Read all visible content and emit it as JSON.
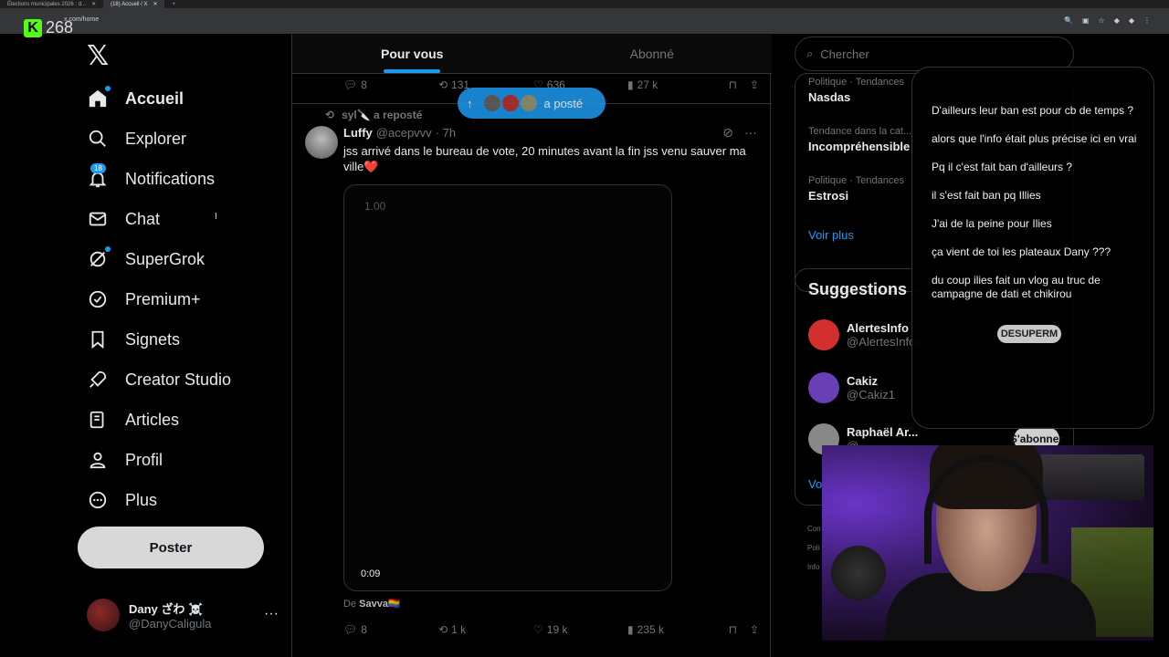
{
  "browser": {
    "tabs": [
      {
        "label": "Élections municipales 2026 : d..."
      },
      {
        "label": "(18) Accueil / X"
      }
    ],
    "url": "x.com/home"
  },
  "stream": {
    "viewer_count": "268"
  },
  "nav": {
    "items": [
      {
        "label": "Accueil",
        "icon": "home-icon"
      },
      {
        "label": "Explorer",
        "icon": "search-icon"
      },
      {
        "label": "Notifications",
        "icon": "bell-icon",
        "badge": "18"
      },
      {
        "label": "Chat",
        "icon": "mail-icon"
      },
      {
        "label": "SuperGrok",
        "icon": "grok-icon"
      },
      {
        "label": "Premium+",
        "icon": "verified-icon"
      },
      {
        "label": "Signets",
        "icon": "bookmark-icon"
      },
      {
        "label": "Creator Studio",
        "icon": "rocket-icon"
      },
      {
        "label": "Articles",
        "icon": "article-icon"
      },
      {
        "label": "Profil",
        "icon": "user-icon"
      },
      {
        "label": "Plus",
        "icon": "more-circle-icon"
      }
    ],
    "post_button": "Poster",
    "account": {
      "name": "Dany ざわ ☠️",
      "handle": "@DanyCaligula"
    }
  },
  "feed": {
    "tabs": [
      {
        "label": "Pour vous"
      },
      {
        "label": "Abonné"
      }
    ],
    "top_actions": {
      "replies": "8",
      "reposts": "131",
      "likes": "636",
      "views": "27 k"
    },
    "new_posts_pill": "a posté",
    "post": {
      "repost_by": "syl🔪 a reposté",
      "author_name": "Luffy",
      "author_handle": "@acepvvv",
      "time": "· 7h",
      "text": "jss arrivé dans le bureau de vote, 20 minutes avant la fin jss venu sauver ma ville❤️",
      "video_rate": "1.00",
      "video_time": "0:09",
      "source_prefix": "De",
      "source_name": "Savva🏳️‍🌈",
      "actions": {
        "replies": "8",
        "reposts": "1 k",
        "likes": "19 k",
        "views": "235 k"
      }
    }
  },
  "right": {
    "search_placeholder": "Chercher",
    "trends": [
      {
        "category": "Politique · Tendances",
        "name": "Nasdas"
      },
      {
        "category": "Tendance dans la cat...",
        "name": "Incompréhensible"
      },
      {
        "category": "Politique · Tendances",
        "name": "Estrosi"
      }
    ],
    "see_more": "Voir plus",
    "suggestions_title": "Suggestions",
    "suggestions": [
      {
        "name": "AlertesInfo",
        "handle": "@AlertesInfos",
        "color": "#d32f2f"
      },
      {
        "name": "Cakiz",
        "handle": "@Cakiz1",
        "color": "#6a3fb5"
      },
      {
        "name": "Raphaël Ar...",
        "handle": "@...",
        "color": "#888888"
      }
    ],
    "follow_label": "S'abonner",
    "voir_small": "Voi",
    "footer": [
      "Con",
      "Poli",
      "Info"
    ]
  },
  "chat_overlay": {
    "messages": [
      "D'ailleurs leur ban est pour cb de temps ?",
      "alors que l'info était plus précise ici en vrai",
      "Pq il c'est fait ban d'ailleurs ?",
      "il s'est fait ban pq Illies",
      "J'ai de la peine pour Ilies",
      "ça vient de toi les plateaux Dany ???",
      "du coup ilies fait un vlog au truc de campagne de dati et chikirou"
    ],
    "ghost_button": "DESUPERM"
  },
  "colors": {
    "accent": "#1d9bf0",
    "background": "#000000",
    "kick_green": "#53fc18"
  }
}
